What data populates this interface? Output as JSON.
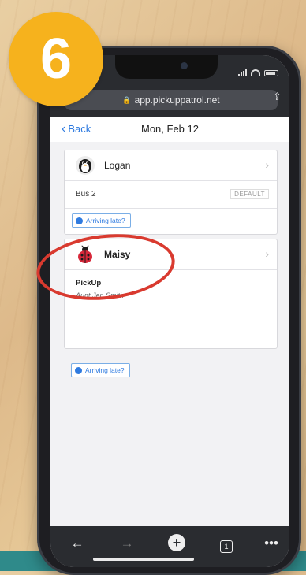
{
  "step_number": "6",
  "browser": {
    "url": "app.pickuppatrol.net"
  },
  "nav": {
    "back_label": "Back",
    "title": "Mon, Feb 12"
  },
  "students": [
    {
      "name": "Logan",
      "avatar_icon": "penguin-icon",
      "transport": "Bus 2",
      "badge": "DEFAULT",
      "late_button": "Arriving late?"
    },
    {
      "name": "Maisy",
      "avatar_icon": "ladybug-icon",
      "pickup_title": "PickUp",
      "pickup_person": "Aunt Jen Smith",
      "late_button": "Arriving late?"
    }
  ],
  "toolbar": {
    "icons": [
      "back-arrow-icon",
      "forward-arrow-icon",
      "new-tab-plus-icon",
      "tabs-icon",
      "more-icon"
    ],
    "tab_count": "1"
  },
  "colors": {
    "accent": "#2f7be0",
    "badge": "#f6b21d",
    "annotation": "#d93a2f"
  }
}
